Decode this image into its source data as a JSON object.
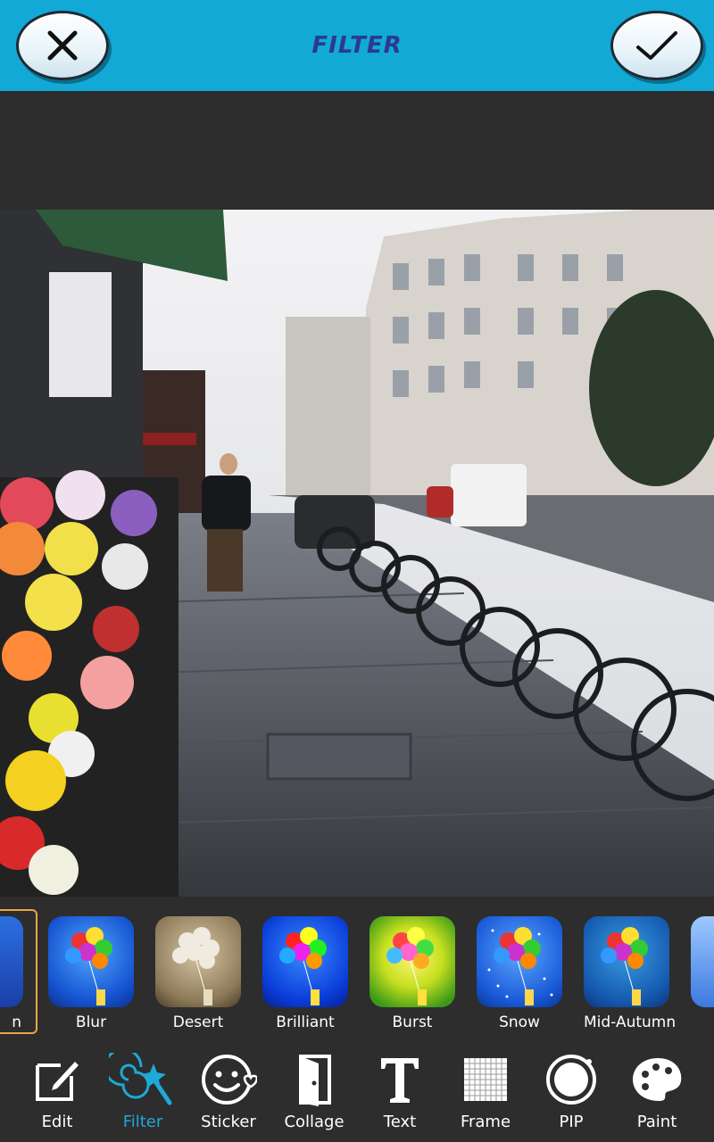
{
  "header": {
    "title": "FILTER"
  },
  "filters": [
    {
      "label": "Blur",
      "style": "blur"
    },
    {
      "label": "Desert",
      "style": "desert"
    },
    {
      "label": "Brilliant",
      "style": "brilliant"
    },
    {
      "label": "Burst",
      "style": "burst"
    },
    {
      "label": "Snow",
      "style": "snow"
    },
    {
      "label": "Mid-Autumn",
      "style": "midautumn"
    }
  ],
  "partial_filter_label": "n",
  "tools": [
    {
      "label": "Edit",
      "icon": "edit-icon"
    },
    {
      "label": "Filter",
      "icon": "filter-wand-icon",
      "active": true
    },
    {
      "label": "Sticker",
      "icon": "sticker-smiley-icon"
    },
    {
      "label": "Collage",
      "icon": "collage-door-icon"
    },
    {
      "label": "Text",
      "icon": "text-t-icon"
    },
    {
      "label": "Frame",
      "icon": "frame-grid-icon"
    },
    {
      "label": "PIP",
      "icon": "pip-circle-icon"
    },
    {
      "label": "Paint",
      "icon": "paint-palette-icon"
    }
  ],
  "colors": {
    "header_bg": "#12a9d6",
    "app_bg": "#2d2d2d",
    "active_tool": "#1ea9d8",
    "selection_border": "#e8a64a"
  }
}
